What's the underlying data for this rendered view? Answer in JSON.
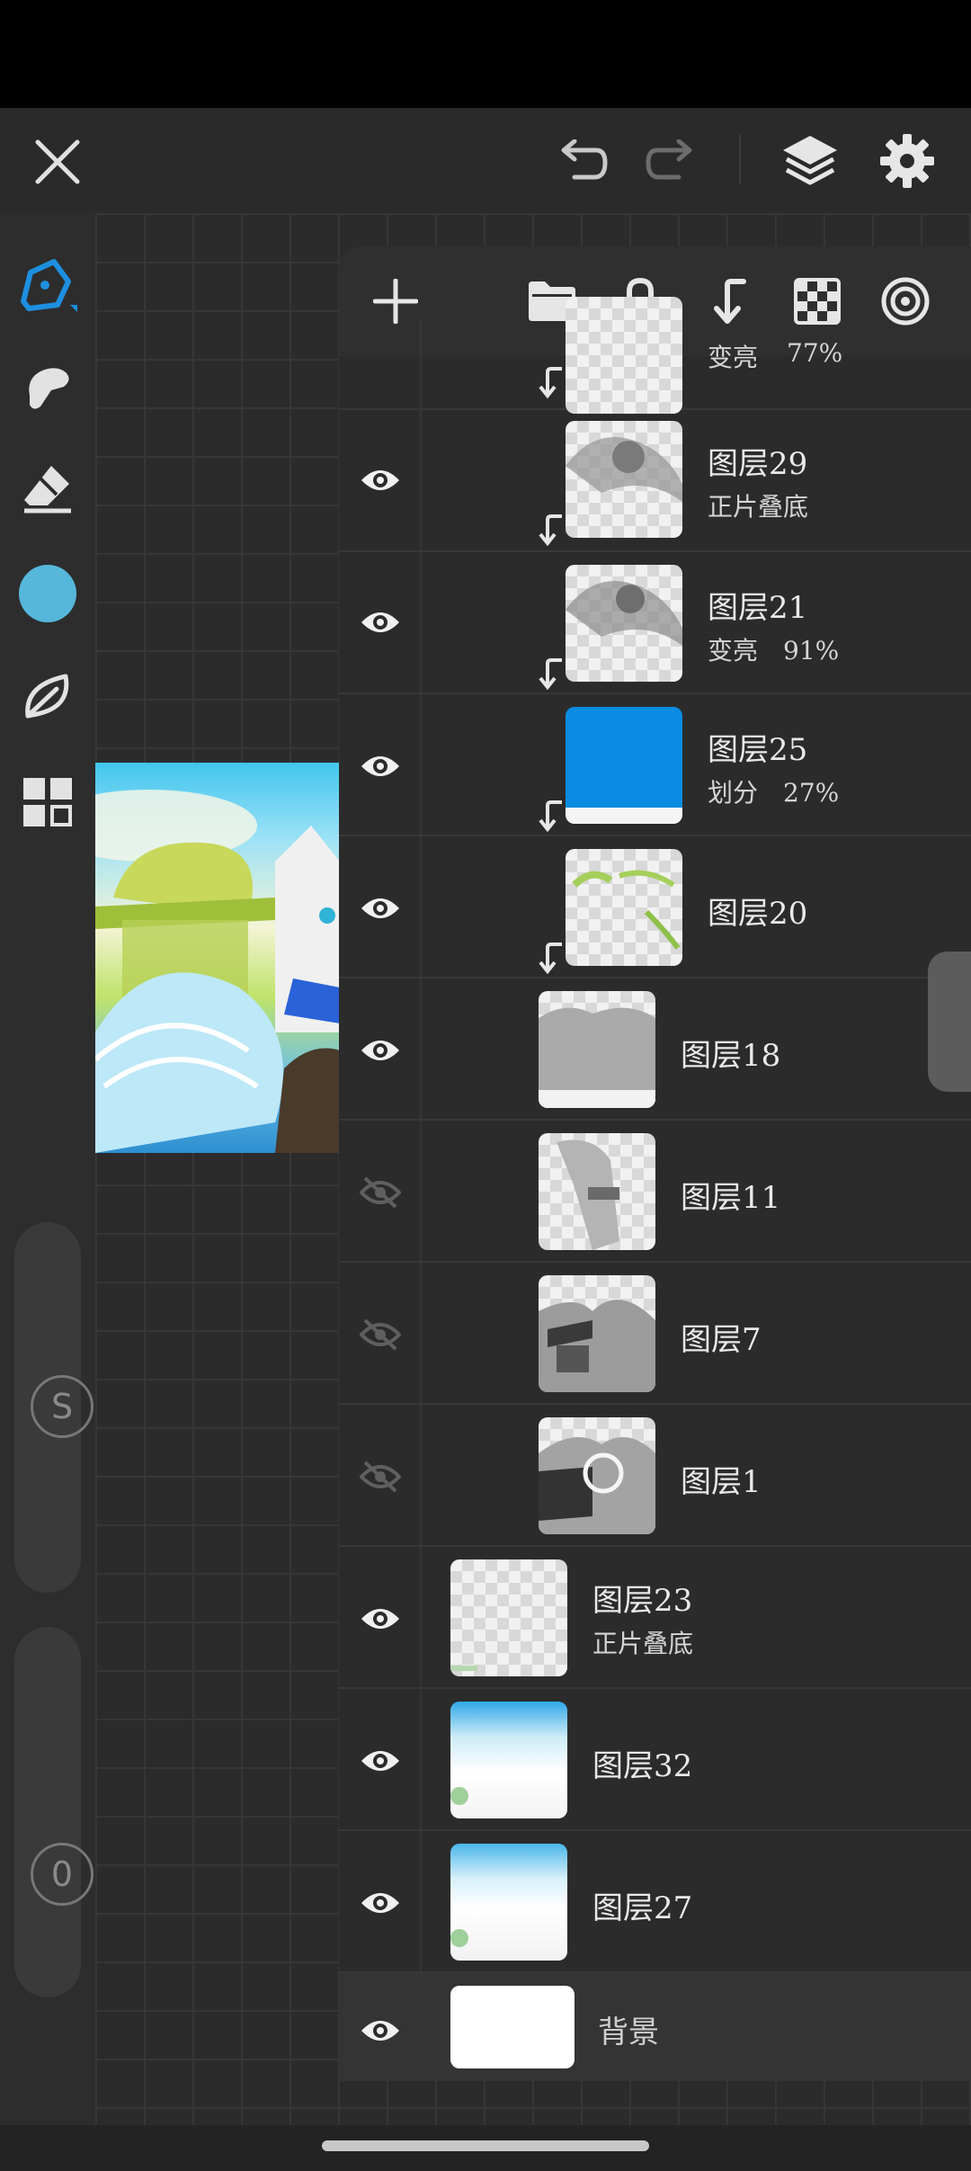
{
  "colors": {
    "accent": "#1e8fe0",
    "current_color": "#56b7db"
  },
  "top_bar": {
    "close": "close-icon",
    "undo": "undo-icon",
    "redo": "redo-icon",
    "layers": "layers-icon",
    "settings": "gear-icon"
  },
  "left_toolbar": {
    "tools": [
      "pen-icon",
      "smudge-icon",
      "eraser-icon",
      "color-swatch",
      "leaf-icon",
      "grid-icon"
    ],
    "size_label": "S",
    "opacity_label": "0"
  },
  "layers_toolbar": [
    "add-icon",
    "folder-icon",
    "lock-icon",
    "clip-down-icon",
    "checker-icon",
    "target-icon"
  ],
  "layers": [
    {
      "name": "变亮",
      "sub": "77%",
      "visible": true,
      "clipped": true,
      "partial": true
    },
    {
      "name": "图层29",
      "sub": "正片叠底",
      "visible": true,
      "clipped": true
    },
    {
      "name": "图层21",
      "sub": "变亮　91%",
      "visible": true,
      "clipped": true
    },
    {
      "name": "图层25",
      "sub": "划分　27%",
      "visible": true,
      "clipped": true
    },
    {
      "name": "图层20",
      "sub": "",
      "visible": true,
      "clipped": true
    },
    {
      "name": "图层18",
      "sub": "",
      "visible": true,
      "clipped": false
    },
    {
      "name": "图层11",
      "sub": "",
      "visible": false,
      "clipped": false
    },
    {
      "name": "图层7",
      "sub": "",
      "visible": false,
      "clipped": false
    },
    {
      "name": "图层1",
      "sub": "",
      "visible": false,
      "clipped": false
    },
    {
      "name": "图层23",
      "sub": "正片叠底",
      "visible": true,
      "clipped": false
    },
    {
      "name": "图层32",
      "sub": "",
      "visible": true,
      "clipped": false
    },
    {
      "name": "图层27",
      "sub": "",
      "visible": true,
      "clipped": false
    },
    {
      "name": "背景",
      "sub": "",
      "visible": true,
      "clipped": false,
      "selected": true
    }
  ]
}
